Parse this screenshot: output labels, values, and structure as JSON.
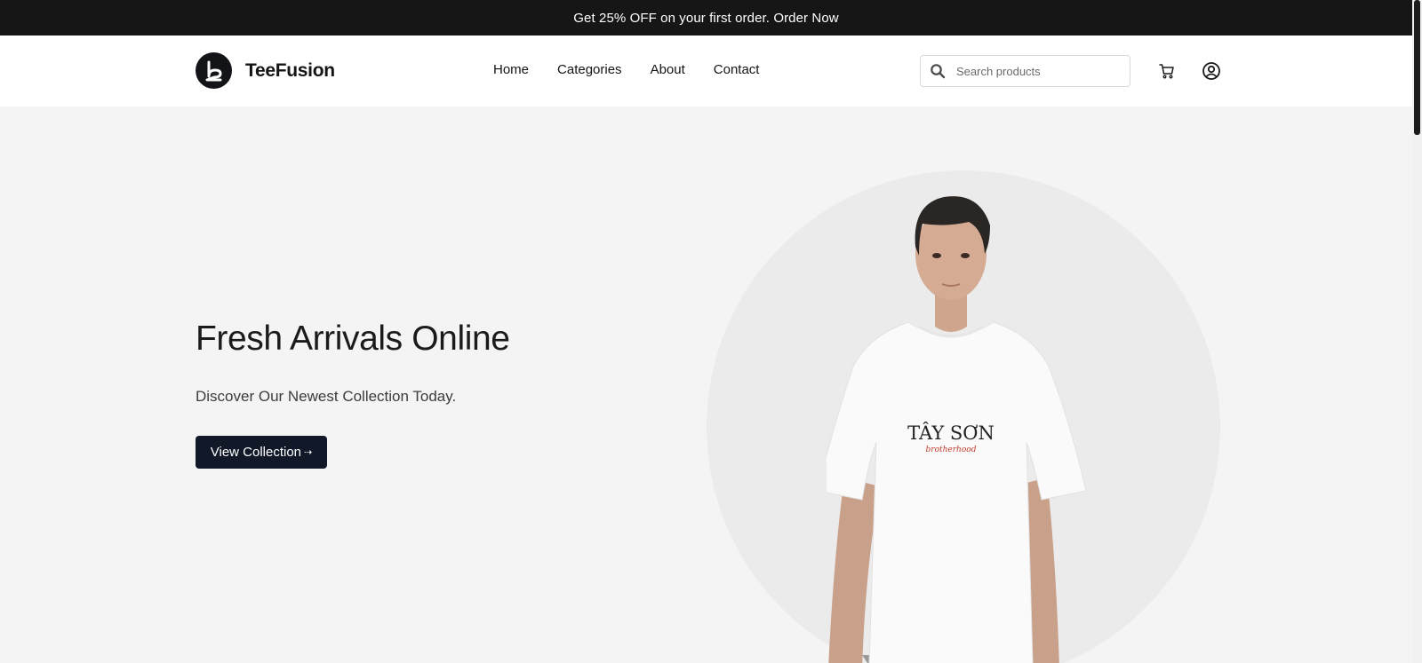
{
  "announcement": {
    "text": "Get 25% OFF on your first order. Order Now"
  },
  "header": {
    "brand": "TeeFusion",
    "nav": [
      {
        "label": "Home"
      },
      {
        "label": "Categories"
      },
      {
        "label": "About"
      },
      {
        "label": "Contact"
      }
    ],
    "search": {
      "placeholder": "Search products",
      "value": ""
    },
    "icons": [
      "search-icon",
      "cart-icon",
      "user-icon"
    ]
  },
  "hero": {
    "title": "Fresh Arrivals Online",
    "subtitle": "Discover Our Newest Collection Today.",
    "button_label": "View Collection",
    "button_arrow": "⇢",
    "tshirt_print": "TÂY SƠN",
    "tshirt_script": "brotherhood"
  },
  "colors": {
    "announcement_bg": "#161616",
    "hero_bg": "#f4f4f4",
    "circle_bg": "#ebebec",
    "button_bg": "#111827",
    "text": "#1b1b1b"
  }
}
